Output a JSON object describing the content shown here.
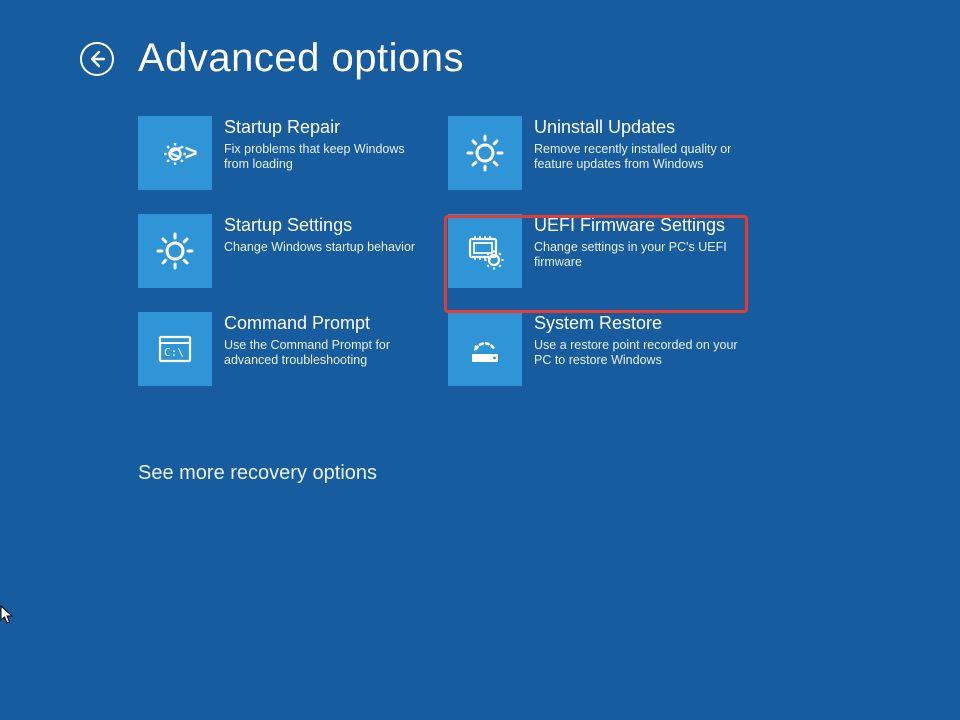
{
  "header": {
    "title": "Advanced options"
  },
  "tiles": {
    "startup_repair": {
      "title": "Startup Repair",
      "desc": "Fix problems that keep Windows from loading"
    },
    "uninstall_updates": {
      "title": "Uninstall Updates",
      "desc": "Remove recently installed quality or feature updates from Windows"
    },
    "startup_settings": {
      "title": "Startup Settings",
      "desc": "Change Windows startup behavior"
    },
    "uefi": {
      "title": "UEFI Firmware Settings",
      "desc": "Change settings in your PC's UEFI firmware"
    },
    "command_prompt": {
      "title": "Command Prompt",
      "desc": "Use the Command Prompt for advanced troubleshooting"
    },
    "system_restore": {
      "title": "System Restore",
      "desc": "Use a restore point recorded on your PC to restore Windows"
    }
  },
  "more_link": "See more recovery options",
  "highlighted_tile": "uefi",
  "colors": {
    "background": "#175c9e",
    "tile": "#3095d6",
    "highlight": "#e63b2e"
  }
}
